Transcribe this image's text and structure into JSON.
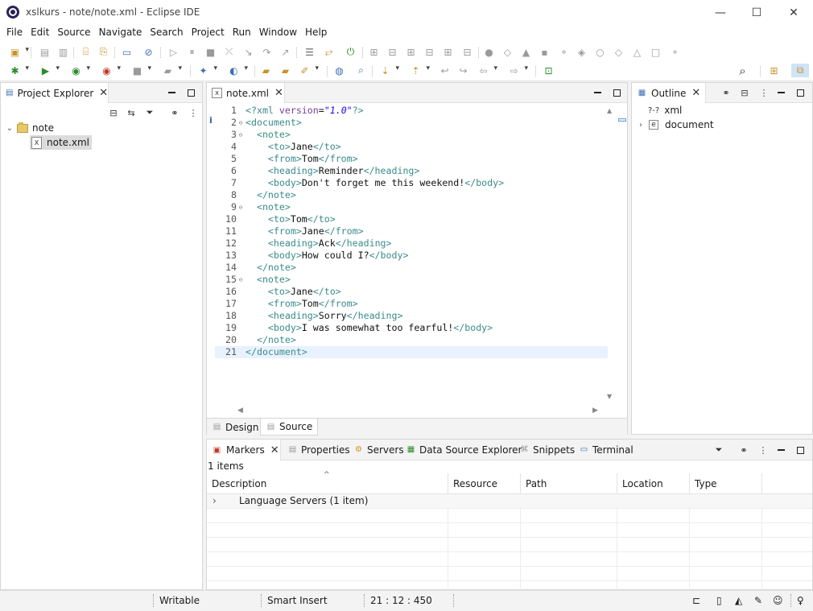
{
  "window": {
    "title": "xslkurs - note/note.xml - Eclipse IDE",
    "minimize_glyph": "—",
    "maximize_glyph": "☐",
    "close_glyph": "✕"
  },
  "menu": [
    "File",
    "Edit",
    "Source",
    "Navigate",
    "Search",
    "Project",
    "Run",
    "Window",
    "Help"
  ],
  "project_explorer": {
    "title": "Project Explorer",
    "tree": {
      "project": "note",
      "file": "note.xml"
    }
  },
  "editor": {
    "tab_label": "note.xml",
    "lines": [
      "<?xml version=\"1.0\"?>",
      "<document>",
      "  <note>",
      "    <to>Jane</to>",
      "    <from>Tom</from>",
      "    <heading>Reminder</heading>",
      "    <body>Don't forget me this weekend!</body>",
      "  </note>",
      "  <note>",
      "    <to>Tom</to>",
      "    <from>Jane</from>",
      "    <heading>Ack</heading>",
      "    <body>How could I?</body>",
      "  </note>",
      "  <note>",
      "    <to>Jane</to>",
      "    <from>Tom</from>",
      "    <heading>Sorry</heading>",
      "    <body>I was somewhat too fearful!</body>",
      "  </note>",
      "</document>"
    ],
    "current_line": 21,
    "bottom_tabs": [
      "Design",
      "Source"
    ],
    "active_bottom_tab": "Source"
  },
  "outline": {
    "title": "Outline",
    "items": [
      {
        "icon": "?-?",
        "label": "xml"
      },
      {
        "icon": "e",
        "label": "document"
      }
    ]
  },
  "bottom_panel": {
    "tabs": [
      "Markers",
      "Properties",
      "Servers",
      "Data Source Explorer",
      "Snippets",
      "Terminal"
    ],
    "active_tab": "Markers",
    "count_text": "1 items",
    "columns": [
      "Description",
      "Resource",
      "Path",
      "Location",
      "Type"
    ],
    "rows": [
      {
        "description": "Language Servers (1 item)",
        "resource": "",
        "path": "",
        "location": "",
        "type": ""
      }
    ]
  },
  "status_bar": {
    "mode": "Writable",
    "insert_mode": "Smart Insert",
    "position": "21 : 12 : 450"
  }
}
